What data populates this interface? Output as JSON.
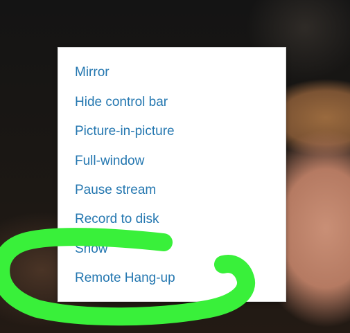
{
  "menu": {
    "items": [
      {
        "label": "Mirror"
      },
      {
        "label": "Hide control bar"
      },
      {
        "label": "Picture-in-picture"
      },
      {
        "label": "Full-window"
      },
      {
        "label": "Pause stream"
      },
      {
        "label": "Record to disk"
      },
      {
        "label": "Show"
      },
      {
        "label": "Remote Hang-up"
      }
    ]
  },
  "colors": {
    "menu_text": "#2477b0",
    "menu_bg": "#ffffff",
    "annotation_stroke": "#39f03a"
  }
}
